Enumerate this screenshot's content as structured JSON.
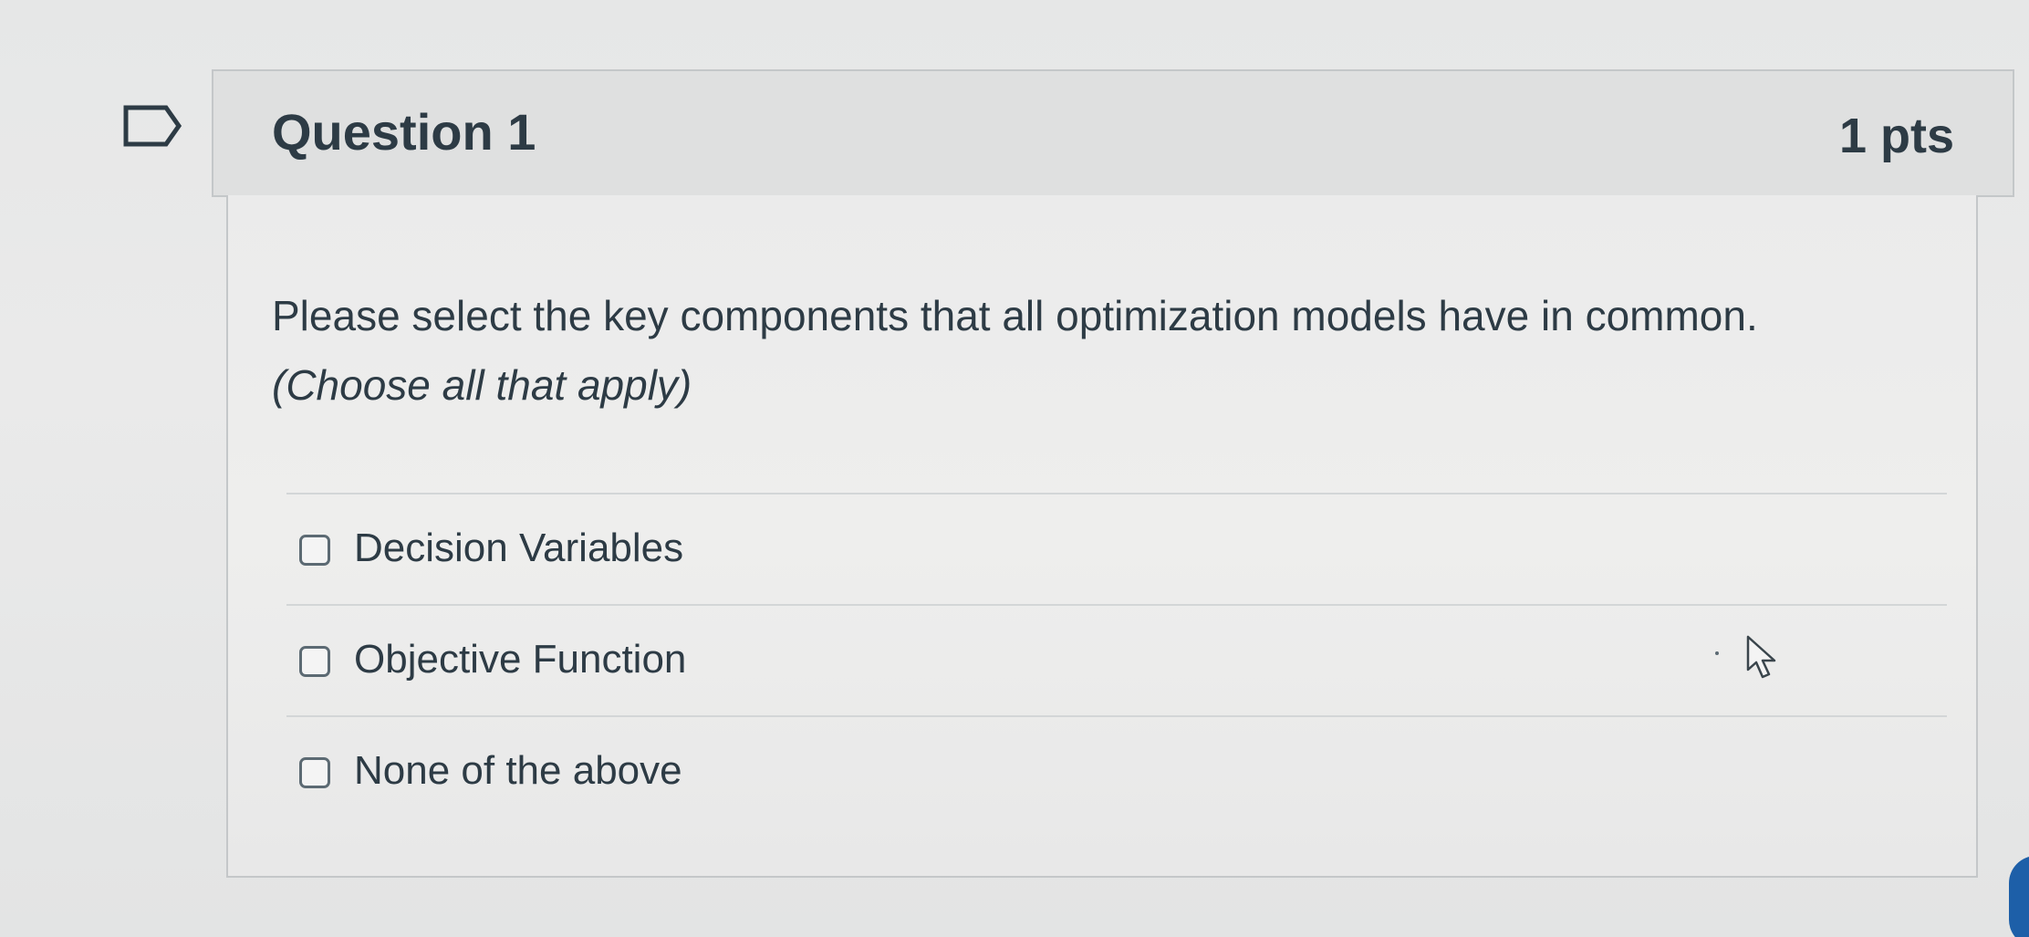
{
  "question": {
    "title": "Question 1",
    "points": "1 pts",
    "prompt": "Please select the key components that all optimization models have in common.",
    "instruction": "(Choose all that apply)"
  },
  "answers": [
    {
      "label": "Decision Variables",
      "checked": false
    },
    {
      "label": "Objective Function",
      "checked": false
    },
    {
      "label": "None of the above",
      "checked": false
    }
  ],
  "icons": {
    "flag": "flag-outline-icon",
    "cursor": "mouse-pointer-icon"
  },
  "colors": {
    "text": "#2d3b45",
    "header_bg": "#dfe0e0",
    "border": "#c4c7c9"
  }
}
